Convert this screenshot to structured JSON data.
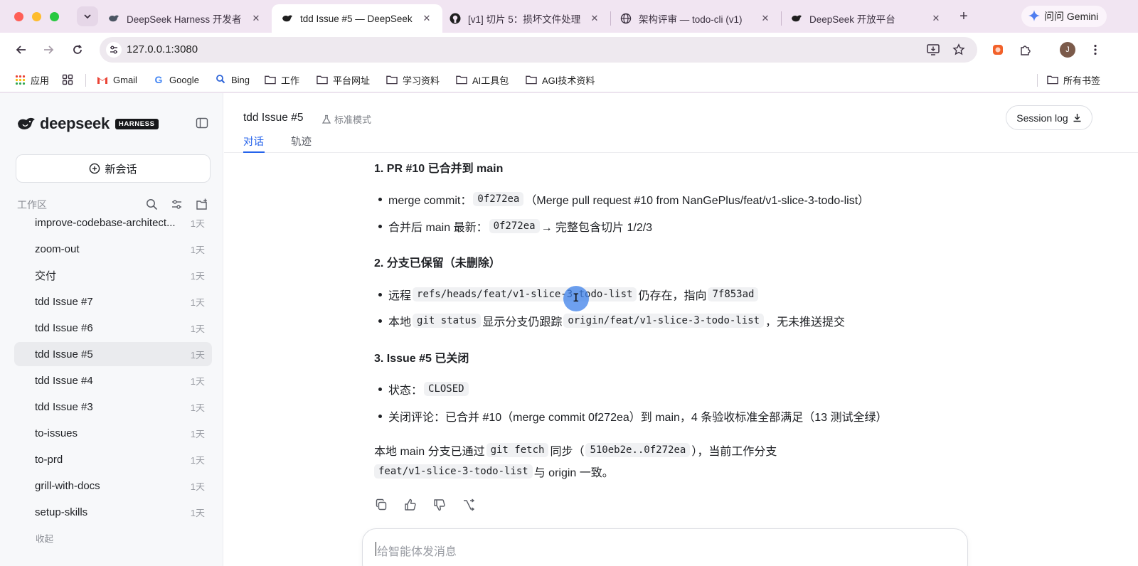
{
  "browser": {
    "tabs": [
      {
        "title": "DeepSeek Harness 开发者",
        "favicon": "deepseek-icon",
        "active": false
      },
      {
        "title": "tdd Issue #5 — DeepSeek",
        "favicon": "deepseek-icon",
        "active": true
      },
      {
        "title": "[v1] 切片 5：损坏文件处理",
        "favicon": "github-icon",
        "active": false
      },
      {
        "title": "架构评审 — todo-cli (v1)",
        "favicon": "globe-icon",
        "active": false
      },
      {
        "title": "DeepSeek 开放平台",
        "favicon": "deepseek-icon",
        "active": false
      }
    ],
    "new_tab": "+",
    "gemini_label": "问问 Gemini",
    "url": "127.0.0.1:3080",
    "avatar_initial": "J",
    "bookmarks": [
      {
        "label": "应用",
        "icon": "apps-grid-icon"
      },
      {
        "label": "",
        "icon": "tab-groups-icon"
      },
      {
        "label": "Gmail",
        "icon": "gmail-icon"
      },
      {
        "label": "Google",
        "icon": "google-icon"
      },
      {
        "label": "Bing",
        "icon": "bing-icon"
      },
      {
        "label": "工作",
        "icon": "folder-icon"
      },
      {
        "label": "平台网址",
        "icon": "folder-icon"
      },
      {
        "label": "学习资料",
        "icon": "folder-icon"
      },
      {
        "label": "AI工具包",
        "icon": "folder-icon"
      },
      {
        "label": "AGI技术资料",
        "icon": "folder-icon"
      }
    ],
    "all_bookmarks": "所有书签"
  },
  "sidebar": {
    "brand": "deepseek",
    "badge": "HARNESS",
    "new_chat": "新会话",
    "workspace_label": "工作区",
    "sessions": [
      {
        "name": "improve-codebase-architect...",
        "time": "1天"
      },
      {
        "name": "zoom-out",
        "time": "1天"
      },
      {
        "name": "交付",
        "time": "1天"
      },
      {
        "name": "tdd Issue #7",
        "time": "1天"
      },
      {
        "name": "tdd Issue #6",
        "time": "1天"
      },
      {
        "name": "tdd Issue #5",
        "time": "1天",
        "active": true
      },
      {
        "name": "tdd Issue #4",
        "time": "1天"
      },
      {
        "name": "tdd Issue #3",
        "time": "1天"
      },
      {
        "name": "to-issues",
        "time": "1天"
      },
      {
        "name": "to-prd",
        "time": "1天"
      },
      {
        "name": "grill-with-docs",
        "time": "1天"
      },
      {
        "name": "setup-skills",
        "time": "1天"
      }
    ],
    "collapse": "收起"
  },
  "header": {
    "title": "tdd Issue #5",
    "mode": "标准模式",
    "session_log": "Session log",
    "tabs": [
      "对话",
      "轨迹"
    ]
  },
  "message": {
    "s1": {
      "heading": "1. PR #10 已合并到 main",
      "i1": {
        "a": "merge commit：",
        "code": "0f272ea",
        "b": "（Merge pull request #10 from NanGePlus/feat/v1-slice-3-todo-list）"
      },
      "i2": {
        "a": "合并后 main 最新：",
        "code": "0f272ea",
        "b": "→ 完整包含切片 1/2/3"
      }
    },
    "s2": {
      "heading": "2. 分支已保留（未删除）",
      "i1": {
        "a": "远程",
        "code1": "refs/heads/feat/v1-slice-3-todo-list",
        "b": "仍存在，指向",
        "code2": "7f853ad"
      },
      "i2": {
        "a": "本地",
        "code1": "git status",
        "b": "显示分支仍跟踪",
        "code2": "origin/feat/v1-slice-3-todo-list",
        "c": "，无未推送提交"
      }
    },
    "s3": {
      "heading": "3. Issue #5 已关闭",
      "i1": {
        "a": "状态：",
        "code": "CLOSED"
      },
      "i2": {
        "a": "关闭评论：已合并 #10（merge commit 0f272ea）到 main，4 条验收标准全部满足（13 测试全绿）"
      }
    },
    "p1": {
      "a": "本地 main 分支已通过",
      "code1": "git fetch",
      "b": "同步（",
      "code2": "510eb2e..0f272ea",
      "c": "），当前工作分支"
    },
    "p2": {
      "code": "feat/v1-slice-3-todo-list",
      "a": "与 origin 一致。"
    }
  },
  "composer": {
    "placeholder": "给智能体发消息"
  },
  "colors": {
    "accent": "#2563eb",
    "tab_strip": "#f1e5f2",
    "cursor_highlight": "#3e80ea"
  }
}
